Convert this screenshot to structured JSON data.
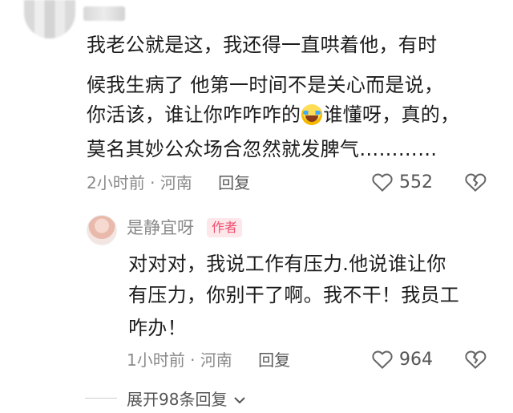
{
  "comment": {
    "lines": [
      "我老公就是这，我还得一直哄着他，有时",
      "候我生病了 他第一时间不是关心而是说，",
      "你活该，谁让你咋咋咋的",
      "谁懂呀，真的，",
      "莫名其妙公众场合忽然就发脾气…………"
    ],
    "emoji_icon": "laughing-crying-emoji",
    "time": "2小时前",
    "separator": "·",
    "location": "河南",
    "reply_label": "回复",
    "likes": "552"
  },
  "reply": {
    "author": "是静宜呀",
    "badge": "作者",
    "lines": [
      "对对对，我说工作有压力.他说谁让你",
      "有压力，你别干了啊。我不干！我员工",
      "咋办！"
    ],
    "time": "1小时前",
    "separator": "·",
    "location": "河南",
    "reply_label": "回复",
    "likes": "964"
  },
  "expand_replies": "展开98条回复",
  "icons": [
    "heart-outline-icon",
    "broken-heart-icon",
    "chevron-down-icon"
  ],
  "colors": {
    "badge_bg": "#fde7ea",
    "badge_text": "#f0506e",
    "meta_text": "#8a8a8a"
  }
}
